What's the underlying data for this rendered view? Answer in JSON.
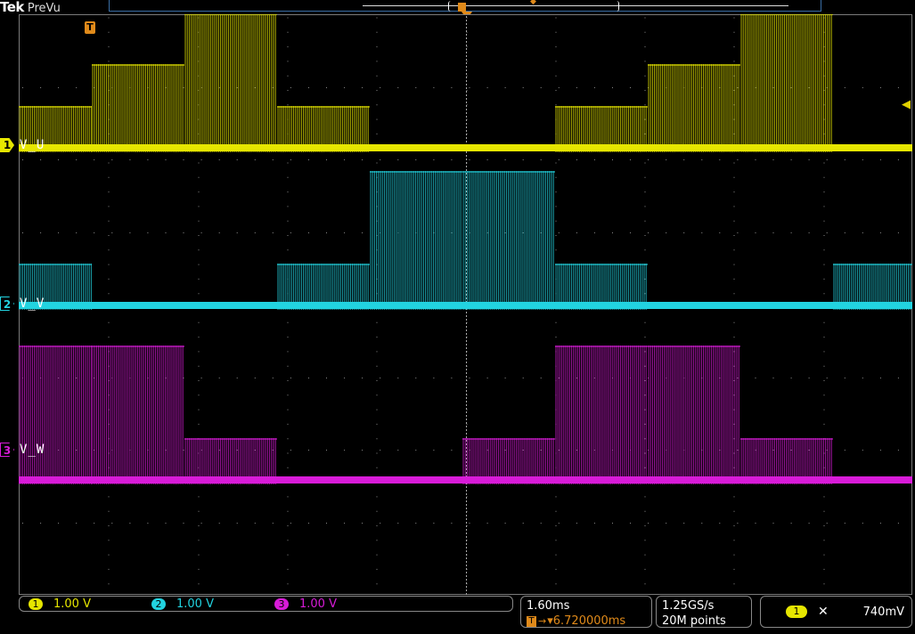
{
  "header": {
    "brand": "Tek",
    "mode": "PreVu"
  },
  "channels": [
    {
      "number": "1",
      "label": "V_U",
      "color": "#e6e600",
      "scale": "1.00 V"
    },
    {
      "number": "2",
      "label": "V_V",
      "color": "#22d3e0",
      "scale": "1.00 V"
    },
    {
      "number": "3",
      "label": "V_W",
      "color": "#d81bd8",
      "scale": "1.00 V"
    }
  ],
  "trigger": {
    "marker": "T",
    "source": "1",
    "slope_symbol": "✕",
    "level": "740mV",
    "color": "#e08a1a"
  },
  "timebase": {
    "scale": "1.60ms",
    "position": "▾6.720000ms",
    "trigger_icon": "T→"
  },
  "acquisition": {
    "sample_rate": "1.25GS/s",
    "record_length": "20M points"
  },
  "waveform_pattern": {
    "V_U": [
      1,
      2,
      3,
      1,
      0,
      0,
      1,
      2,
      3
    ],
    "V_V": [
      1,
      0,
      0,
      1,
      3,
      3,
      1,
      0,
      0,
      1
    ],
    "V_W": [
      3,
      3,
      1,
      0,
      0,
      1,
      3,
      3,
      1,
      0
    ]
  }
}
